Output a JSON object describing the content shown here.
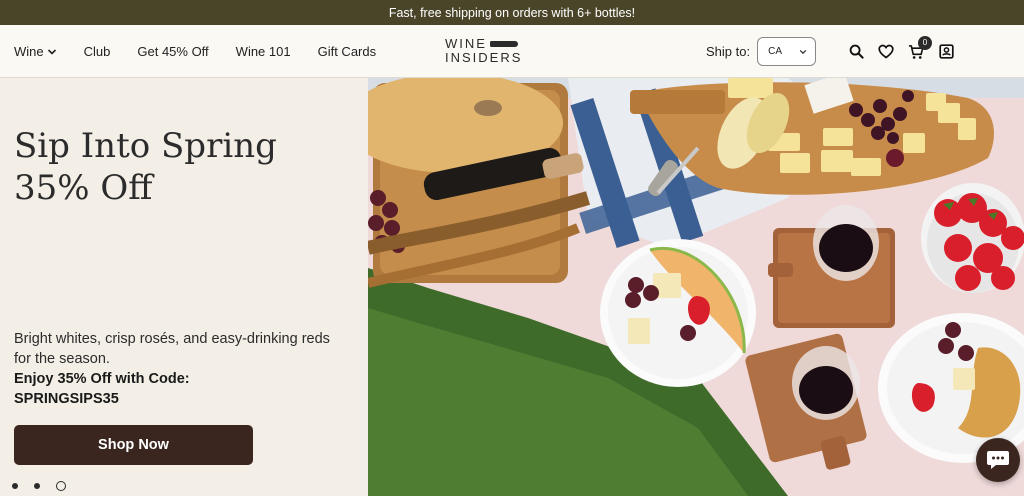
{
  "promo": {
    "text": "Fast, free shipping on orders with 6+ bottles!"
  },
  "nav": {
    "items": [
      {
        "label": "Wine",
        "has_dropdown": true,
        "icon": "chevron-down-icon"
      },
      {
        "label": "Club"
      },
      {
        "label": "Get 45% Off"
      },
      {
        "label": "Wine 101"
      },
      {
        "label": "Gift Cards"
      }
    ]
  },
  "logo": {
    "line1": "WINE",
    "line2": "INSIDERS"
  },
  "ship_to": {
    "label": "Ship to:",
    "selected": "CA"
  },
  "header_icons": {
    "search": "search-icon",
    "wishlist": "heart-icon",
    "cart": "cart-icon",
    "cart_count": "0",
    "account": "account-icon"
  },
  "hero": {
    "title_line1": "Sip Into Spring",
    "title_line2": "35% Off",
    "description": "Bright whites, crisp rosés, and easy-drinking reds for the season.",
    "code_line1": "Enjoy 35% Off with Code:",
    "code_line2": "SPRINGSIPS35",
    "cta": "Shop Now",
    "slides_total": 3,
    "active_slide": 3
  },
  "chat": {
    "icon": "chat-icon"
  },
  "colors": {
    "promo_bg": "#4a4528",
    "button": "#3a261f",
    "hero_bg": "#f3efe7",
    "header_bg": "#fbf9f4"
  }
}
